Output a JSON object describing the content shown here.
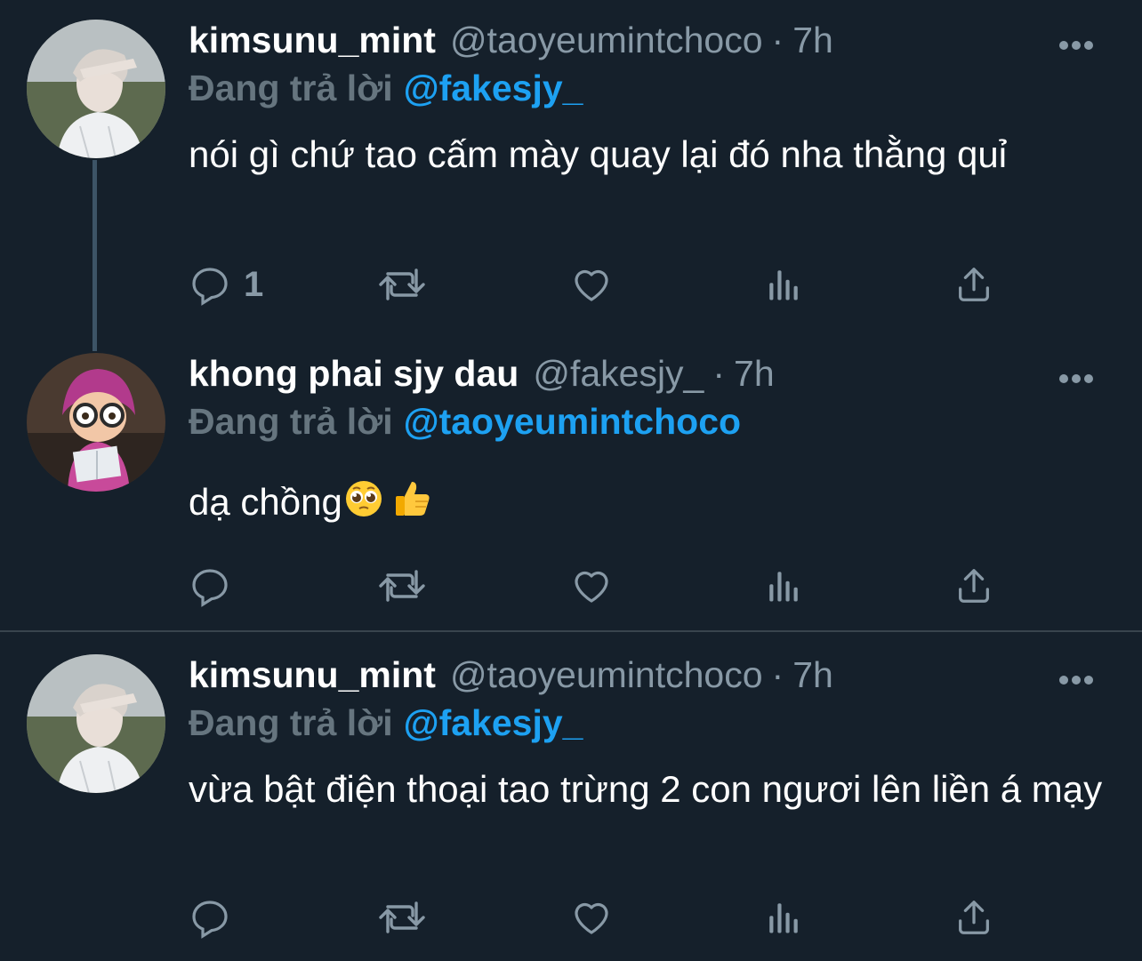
{
  "colors": {
    "background": "#15202b",
    "accent": "#1da1f2",
    "secondary_text": "#8899a6",
    "divider": "#38444d"
  },
  "tweets": [
    {
      "display_name": "kimsunu_mint",
      "handle": "@taoyeumintchoco",
      "separator": "·",
      "time": "7h",
      "reply_prefix": "Đang trả lời",
      "reply_to": "@fakesjy_",
      "text": "nói gì chứ tao cấm mày quay lại đó nha thằng quỉ",
      "reply_count": "1",
      "avatar": "avatar-photo-icon"
    },
    {
      "display_name": "khong phai sjy dau",
      "handle": "@fakesjy_",
      "separator": "·",
      "time": "7h",
      "reply_prefix": "Đang trả lời",
      "reply_to": "@taoyeumintchoco",
      "text": "dạ chồng",
      "emojis": [
        "pleading-face-emoji",
        "thumbs-up-emoji"
      ],
      "reply_count": "",
      "avatar": "avatar-cartoon-icon"
    },
    {
      "display_name": "kimsunu_mint",
      "handle": "@taoyeumintchoco",
      "separator": "·",
      "time": "7h",
      "reply_prefix": "Đang trả lời",
      "reply_to": "@fakesjy_",
      "text": "vừa bật điện thoại tao trừng 2 con ngươi lên liền á mạy",
      "reply_count": "",
      "avatar": "avatar-photo-icon"
    }
  ],
  "icons": {
    "reply": "reply-icon",
    "retweet": "retweet-icon",
    "like": "heart-icon",
    "analytics": "analytics-icon",
    "share": "share-icon",
    "more": "more-options-icon"
  }
}
